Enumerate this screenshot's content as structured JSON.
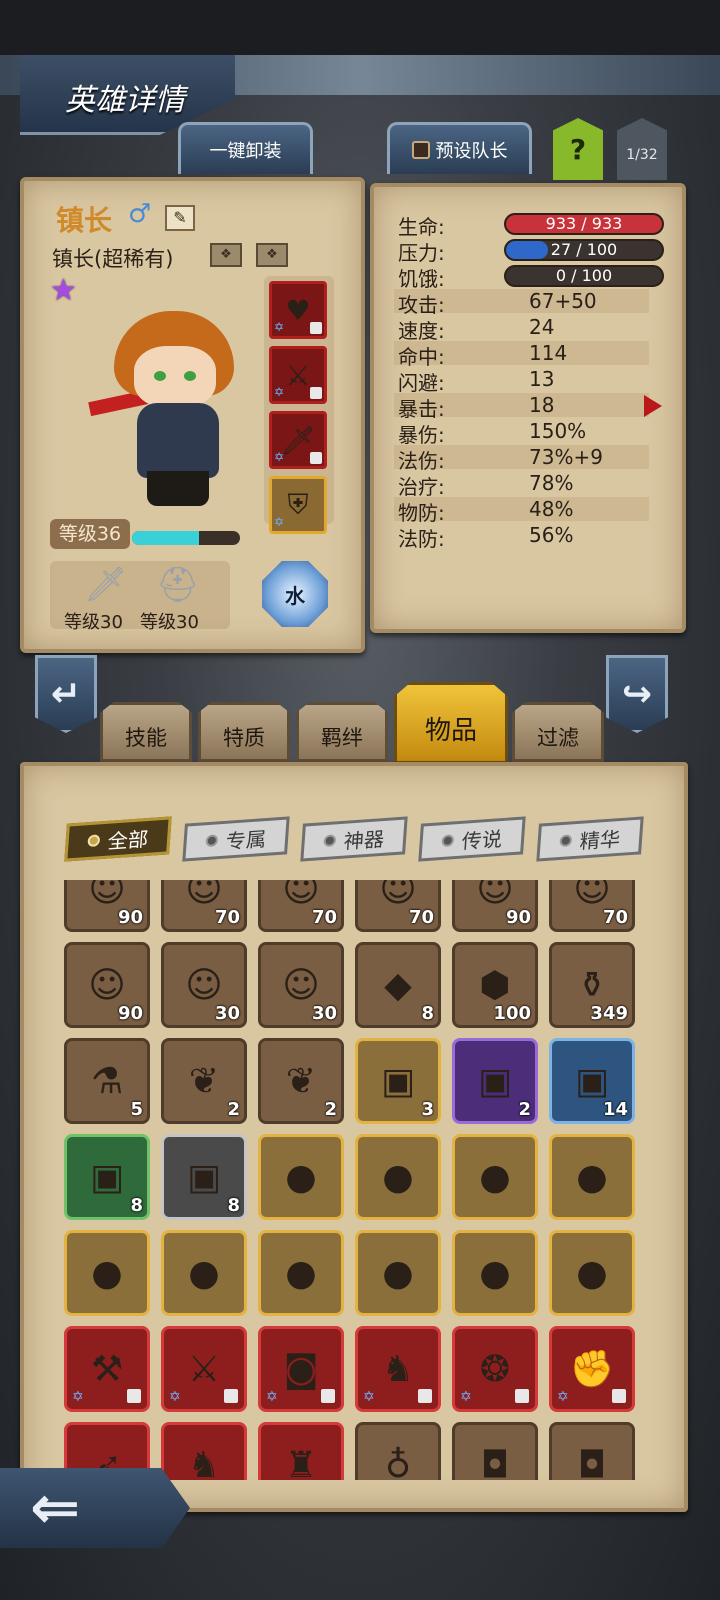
{
  "header": {
    "title": "英雄详情"
  },
  "top_actions": {
    "unequip_all": "一键卸装",
    "preset_captain": "预设队长",
    "help": "?",
    "page_indicator": "1/32"
  },
  "hero": {
    "name": "镇长",
    "class": "镇长(超稀有)",
    "level_label": "等级36",
    "xp_fraction": 0.62,
    "weapon_level": "等级30",
    "armor_level": "等级30",
    "element": "水",
    "equipment_slots": [
      "red",
      "red",
      "red",
      "gold"
    ]
  },
  "stats": {
    "hp": {
      "label": "生命:",
      "value": "933 / 933",
      "fraction": 1.0,
      "color": "#c8323a"
    },
    "stress": {
      "label": "压力:",
      "value": "27 / 100",
      "fraction": 0.27,
      "color": "#2e68c8"
    },
    "hunger": {
      "label": "饥饿:",
      "value": "0 / 100",
      "fraction": 0.0,
      "color": "#888888"
    },
    "rows": [
      {
        "label": "攻击:",
        "value": "67+50"
      },
      {
        "label": "速度:",
        "value": "24"
      },
      {
        "label": "命中:",
        "value": "114"
      },
      {
        "label": "闪避:",
        "value": "13"
      },
      {
        "label": "暴击:",
        "value": "18"
      },
      {
        "label": "暴伤:",
        "value": "150%"
      },
      {
        "label": "法伤:",
        "value": "73%+9"
      },
      {
        "label": "治疗:",
        "value": "78%"
      },
      {
        "label": "物防:",
        "value": "48%"
      },
      {
        "label": "法防:",
        "value": "56%"
      }
    ]
  },
  "main_tabs": [
    "技能",
    "特质",
    "羁绊",
    "物品",
    "过滤"
  ],
  "active_tab": "物品",
  "filters": [
    "全部",
    "专属",
    "神器",
    "传说",
    "精华"
  ],
  "active_filter": "全部",
  "items": [
    {
      "icon": "hero-portrait-icon",
      "glyph": "☺",
      "rarity": "r-brown",
      "qty": "90"
    },
    {
      "icon": "hero-portrait-icon",
      "glyph": "☺",
      "rarity": "r-brown",
      "qty": "70"
    },
    {
      "icon": "hero-portrait-icon",
      "glyph": "☺",
      "rarity": "r-brown",
      "qty": "70"
    },
    {
      "icon": "hero-portrait-icon",
      "glyph": "☺",
      "rarity": "r-brown",
      "qty": "70"
    },
    {
      "icon": "hero-portrait-icon",
      "glyph": "☺",
      "rarity": "r-brown",
      "qty": "90"
    },
    {
      "icon": "hero-portrait-icon",
      "glyph": "☺",
      "rarity": "r-brown",
      "qty": "70"
    },
    {
      "icon": "hero-portrait-icon",
      "glyph": "☺",
      "rarity": "r-brown",
      "qty": "90"
    },
    {
      "icon": "hero-portrait-icon",
      "glyph": "☺",
      "rarity": "r-brown",
      "qty": "30"
    },
    {
      "icon": "hero-portrait-icon",
      "glyph": "☺",
      "rarity": "r-brown",
      "qty": "30"
    },
    {
      "icon": "orange-gem-icon",
      "glyph": "◆",
      "rarity": "r-brown",
      "qty": "8"
    },
    {
      "icon": "teal-rune-icon",
      "glyph": "⬢",
      "rarity": "r-brown",
      "qty": "100"
    },
    {
      "icon": "teal-potion-icon",
      "glyph": "⚱",
      "rarity": "r-brown",
      "qty": "349"
    },
    {
      "icon": "purple-potion-icon",
      "glyph": "⚗",
      "rarity": "r-brown",
      "qty": "5"
    },
    {
      "icon": "feather-icon",
      "glyph": "❦",
      "rarity": "r-brown",
      "qty": "2"
    },
    {
      "icon": "feather-icon",
      "glyph": "❦",
      "rarity": "r-brown",
      "qty": "2"
    },
    {
      "icon": "chest-icon",
      "glyph": "▣",
      "rarity": "r-gold",
      "qty": "3"
    },
    {
      "icon": "chest-icon",
      "glyph": "▣",
      "rarity": "r-purple",
      "qty": "2"
    },
    {
      "icon": "chest-icon",
      "glyph": "▣",
      "rarity": "r-blue",
      "qty": "14"
    },
    {
      "icon": "chest-icon",
      "glyph": "▣",
      "rarity": "r-green",
      "qty": "8"
    },
    {
      "icon": "chest-icon",
      "glyph": "▣",
      "rarity": "r-grey",
      "qty": "8"
    },
    {
      "icon": "green-orb-icon",
      "glyph": "●",
      "rarity": "r-gold",
      "qty": ""
    },
    {
      "icon": "green-orb-icon",
      "glyph": "●",
      "rarity": "r-gold",
      "qty": ""
    },
    {
      "icon": "green-orb-icon",
      "glyph": "●",
      "rarity": "r-gold",
      "qty": ""
    },
    {
      "icon": "green-orb-icon",
      "glyph": "●",
      "rarity": "r-gold",
      "qty": ""
    },
    {
      "icon": "green-orb-icon",
      "glyph": "●",
      "rarity": "r-gold",
      "qty": ""
    },
    {
      "icon": "green-orb-icon",
      "glyph": "●",
      "rarity": "r-gold",
      "qty": ""
    },
    {
      "icon": "green-orb-icon",
      "glyph": "●",
      "rarity": "r-gold",
      "qty": ""
    },
    {
      "icon": "green-orb-icon",
      "glyph": "●",
      "rarity": "r-gold",
      "qty": ""
    },
    {
      "icon": "green-orb-icon",
      "glyph": "●",
      "rarity": "r-gold",
      "qty": ""
    },
    {
      "icon": "green-orb-icon",
      "glyph": "●",
      "rarity": "r-gold",
      "qty": ""
    },
    {
      "icon": "hammer-icon",
      "glyph": "⚒",
      "rarity": "r-red",
      "qty": "",
      "locked": true
    },
    {
      "icon": "blade-icon",
      "glyph": "⚔",
      "rarity": "r-red",
      "qty": "",
      "locked": true
    },
    {
      "icon": "backpack-icon",
      "glyph": "◙",
      "rarity": "r-red",
      "qty": "",
      "locked": true
    },
    {
      "icon": "helmet-icon",
      "glyph": "♞",
      "rarity": "r-red",
      "qty": "",
      "locked": true
    },
    {
      "icon": "crystal-ring-icon",
      "glyph": "❂",
      "rarity": "r-red",
      "qty": "",
      "locked": true
    },
    {
      "icon": "gauntlet-icon",
      "glyph": "✊",
      "rarity": "r-red",
      "qty": "",
      "locked": true
    },
    {
      "icon": "bow-icon",
      "glyph": "➶",
      "rarity": "r-red",
      "qty": ""
    },
    {
      "icon": "helmet-icon",
      "glyph": "♞",
      "rarity": "r-red",
      "qty": ""
    },
    {
      "icon": "cloak-icon",
      "glyph": "♜",
      "rarity": "r-red",
      "qty": ""
    },
    {
      "icon": "amulet-icon",
      "glyph": "♁",
      "rarity": "r-brown",
      "qty": ""
    },
    {
      "icon": "bag-icon",
      "glyph": "◘",
      "rarity": "r-brown",
      "qty": ""
    },
    {
      "icon": "bag-icon",
      "glyph": "◘",
      "rarity": "r-brown",
      "qty": ""
    }
  ]
}
